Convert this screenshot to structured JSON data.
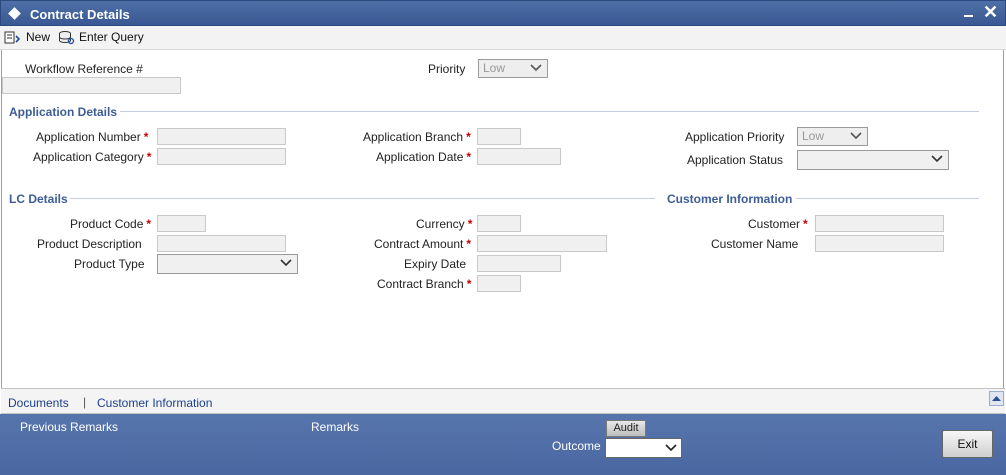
{
  "window": {
    "title": "Contract Details"
  },
  "toolbar": {
    "new_label": "New",
    "enter_query_label": "Enter Query"
  },
  "header": {
    "workflow_ref_label": "Workflow Reference #",
    "workflow_ref_value": "",
    "priority_label": "Priority",
    "priority_value": "Low"
  },
  "application": {
    "section_title": "Application Details",
    "number_label": "Application Number",
    "category_label": "Application Category",
    "branch_label": "Application Branch",
    "date_label": "Application Date",
    "priority_label": "Application Priority",
    "priority_value": "Low",
    "status_label": "Application Status",
    "status_value": ""
  },
  "lc": {
    "section_title": "LC Details",
    "product_code_label": "Product Code",
    "product_description_label": "Product Description",
    "product_type_label": "Product Type",
    "product_type_value": "",
    "currency_label": "Currency",
    "contract_amount_label": "Contract Amount",
    "expiry_date_label": "Expiry Date",
    "contract_branch_label": "Contract Branch"
  },
  "customer": {
    "section_title": "Customer Information",
    "customer_label": "Customer",
    "customer_name_label": "Customer Name"
  },
  "required_mark": "*",
  "links": {
    "documents": "Documents",
    "separator": "|",
    "customer_information": "Customer Information"
  },
  "footer": {
    "previous_remarks_label": "Previous Remarks",
    "remarks_label": "Remarks",
    "audit_label": "Audit",
    "outcome_label": "Outcome",
    "outcome_value": "",
    "exit_label": "Exit"
  }
}
